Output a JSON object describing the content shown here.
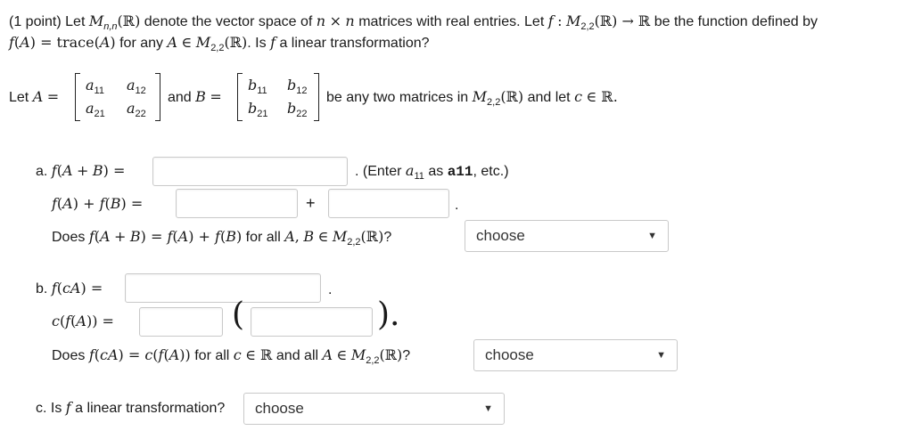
{
  "intro": {
    "line1": {
      "prefix": "(1 point) Let",
      "text1": "denote the vector space of",
      "text2": "matrices with real entries. Let",
      "text3": "be the function defined by"
    },
    "line2": {
      "text1": "for any",
      "text2": ". Is",
      "text3": "a linear transformation?"
    }
  },
  "setup": {
    "let_label": "Let",
    "and_label": "and",
    "tail_text": "be any two matrices in",
    "tail_text2": "and let",
    "matrixA": [
      "a",
      "11",
      "a",
      "12",
      "a",
      "21",
      "a",
      "22"
    ],
    "matrixB": [
      "b",
      "11",
      "b",
      "12",
      "b",
      "21",
      "b",
      "22"
    ]
  },
  "part_a": {
    "label": "a.",
    "hint_prefix": ". (Enter",
    "hint_mid": "as",
    "hint_code": "a11",
    "hint_suffix": ", etc.)",
    "plus": "+",
    "period": ".",
    "question_prefix": "Does",
    "question_mid": "for all",
    "question_suffix": "?",
    "select_value": "choose"
  },
  "part_b": {
    "label": "b.",
    "period": ".",
    "question_prefix": "Does",
    "question_mid1": "for all",
    "question_mid2": "and all",
    "question_suffix": "?",
    "select_value": "choose"
  },
  "part_c": {
    "label": "c. Is",
    "text": "a linear transformation?",
    "select_value": "choose"
  }
}
